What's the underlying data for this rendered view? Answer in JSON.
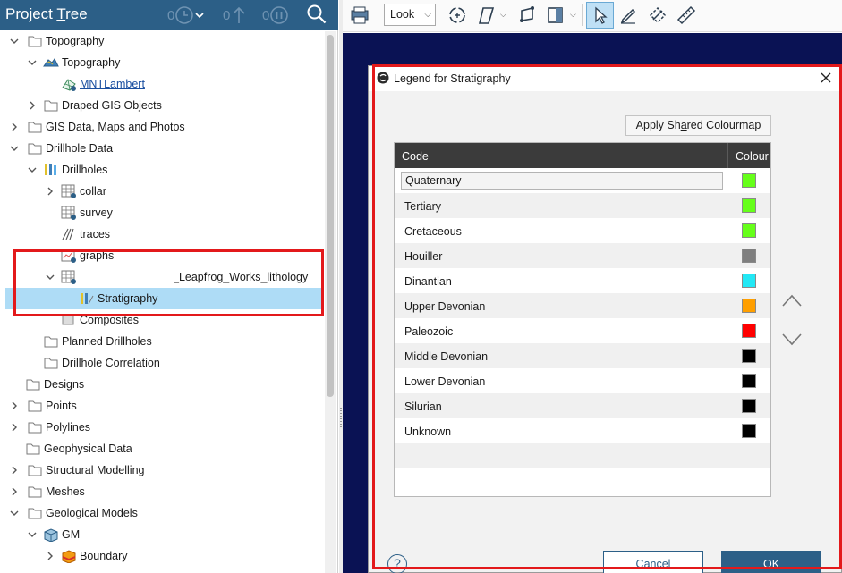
{
  "project_tree": {
    "title": "Project Tree",
    "header_counts": [
      "0",
      "0",
      "0"
    ],
    "items": [
      {
        "label": "Topography",
        "icon": "folder-icon",
        "expanded": true
      },
      {
        "label": "Topography",
        "icon": "topography-surface-icon",
        "expanded": true
      },
      {
        "label": "MNTLambert",
        "icon": "grid-mesh-icon",
        "link": true
      },
      {
        "label": "Draped GIS Objects",
        "icon": "folder-icon",
        "expanded": false
      },
      {
        "label": "GIS Data, Maps and Photos",
        "icon": "folder-icon",
        "expanded": false
      },
      {
        "label": "Drillhole Data",
        "icon": "folder-icon",
        "expanded": true
      },
      {
        "label": "Drillholes",
        "icon": "drillholes-icon",
        "expanded": true
      },
      {
        "label": "collar",
        "icon": "table-icon",
        "expanded": false
      },
      {
        "label": "survey",
        "icon": "table-icon"
      },
      {
        "label": "traces",
        "icon": "traces-icon"
      },
      {
        "label": "graphs",
        "icon": "graphs-icon"
      },
      {
        "label": "_Leapfrog_Works_lithology",
        "icon": "table-icon",
        "expanded": true
      },
      {
        "label": "Stratigraphy",
        "icon": "stratigraphy-icon",
        "selected": true
      },
      {
        "label": "Composites",
        "icon": "composites-icon"
      },
      {
        "label": "Planned Drillholes",
        "icon": "folder-icon"
      },
      {
        "label": "Drillhole Correlation",
        "icon": "folder-icon"
      },
      {
        "label": "Designs",
        "icon": "folder-icon"
      },
      {
        "label": "Points",
        "icon": "folder-icon",
        "expanded": false
      },
      {
        "label": "Polylines",
        "icon": "folder-icon",
        "expanded": false
      },
      {
        "label": "Geophysical Data",
        "icon": "folder-icon"
      },
      {
        "label": "Structural Modelling",
        "icon": "folder-icon",
        "expanded": false
      },
      {
        "label": "Meshes",
        "icon": "folder-icon",
        "expanded": false
      },
      {
        "label": "Geological Models",
        "icon": "folder-icon",
        "expanded": true
      },
      {
        "label": "GM",
        "icon": "geological-model-icon",
        "expanded": true
      },
      {
        "label": "Boundary",
        "icon": "boundary-icon",
        "expanded": false
      }
    ]
  },
  "toolbar": {
    "look_label": "Look",
    "tools": [
      "print-icon",
      "rotate-icon",
      "slice-icon",
      "draw-slice-icon",
      "clip-icon",
      "select-icon",
      "draw-icon",
      "ruler-flip-icon",
      "measure-icon"
    ]
  },
  "dialog": {
    "title": "Legend for Stratigraphy",
    "apply_label": "Apply Shared Colourmap",
    "col_code": "Code",
    "col_colour": "Colour",
    "rows": [
      {
        "code": "Quaternary",
        "colour": "#66ff1a"
      },
      {
        "code": "Tertiary",
        "colour": "#66ff1a"
      },
      {
        "code": "Cretaceous",
        "colour": "#66ff1a"
      },
      {
        "code": "Houiller",
        "colour": "#7f7f7f"
      },
      {
        "code": "Dinantian",
        "colour": "#22e8f5"
      },
      {
        "code": "Upper Devonian",
        "colour": "#ff9f00"
      },
      {
        "code": "Paleozoic",
        "colour": "#ff0000"
      },
      {
        "code": "Middle Devonian",
        "colour": "#000000"
      },
      {
        "code": "Lower Devonian",
        "colour": "#000000"
      },
      {
        "code": "Silurian",
        "colour": "#000000"
      },
      {
        "code": "Unknown",
        "colour": "#000000"
      }
    ],
    "help_label": "?",
    "cancel_label": "Cancel",
    "ok_label": "OK"
  },
  "colors": {
    "header_bg": "#2c5f87",
    "viewport_bg": "#0a1254",
    "selection": "#aedcf6",
    "highlight_box": "#e3191b"
  }
}
